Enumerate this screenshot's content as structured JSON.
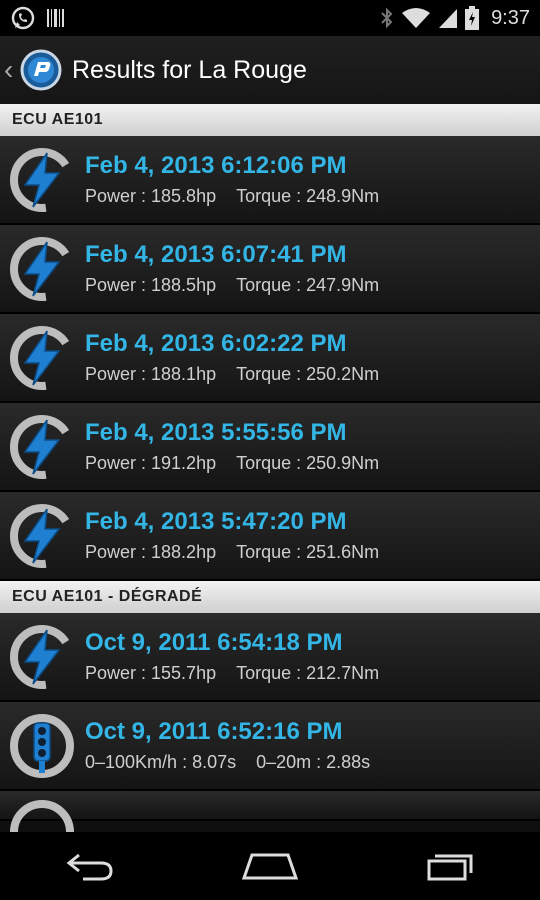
{
  "status_bar": {
    "time": "9:37",
    "icons": [
      "whatsapp-icon",
      "barcode-icon",
      "bluetooth-icon",
      "wifi-icon",
      "signal-icon",
      "battery-icon"
    ]
  },
  "action_bar": {
    "title": "Results for La Rouge",
    "logo_icon": "app-logo-icon"
  },
  "sections": [
    {
      "header": "ECU AE101",
      "items": [
        {
          "date": "Feb 4, 2013 6:12:06 PM",
          "power": "Power : 185.8hp",
          "torque": "Torque : 248.9Nm",
          "icon": "dyno-bolt-icon"
        },
        {
          "date": "Feb 4, 2013 6:07:41 PM",
          "power": "Power : 188.5hp",
          "torque": "Torque : 247.9Nm",
          "icon": "dyno-bolt-icon"
        },
        {
          "date": "Feb 4, 2013 6:02:22 PM",
          "power": "Power : 188.1hp",
          "torque": "Torque : 250.2Nm",
          "icon": "dyno-bolt-icon"
        },
        {
          "date": "Feb 4, 2013 5:55:56 PM",
          "power": "Power : 191.2hp",
          "torque": "Torque : 250.9Nm",
          "icon": "dyno-bolt-icon"
        },
        {
          "date": "Feb 4, 2013 5:47:20 PM",
          "power": "Power : 188.2hp",
          "torque": "Torque : 251.6Nm",
          "icon": "dyno-bolt-icon"
        }
      ]
    },
    {
      "header": "ECU AE101 - DÉGRADÉ",
      "items": [
        {
          "date": "Oct 9, 2011 6:54:18 PM",
          "power": "Power : 155.7hp",
          "torque": "Torque : 212.7Nm",
          "icon": "dyno-bolt-icon"
        },
        {
          "date": "Oct 9, 2011 6:52:16 PM",
          "power": "0–100Km/h : 8.07s",
          "torque": "0–20m : 2.88s",
          "icon": "traffic-light-icon"
        }
      ]
    }
  ],
  "colors": {
    "accent": "#33b5e5",
    "section_header_bg": "#e0e0e0",
    "row_bg": "#1e1e1e"
  },
  "nav_bar": {
    "buttons": [
      "back-icon",
      "home-icon",
      "recent-apps-icon"
    ]
  }
}
